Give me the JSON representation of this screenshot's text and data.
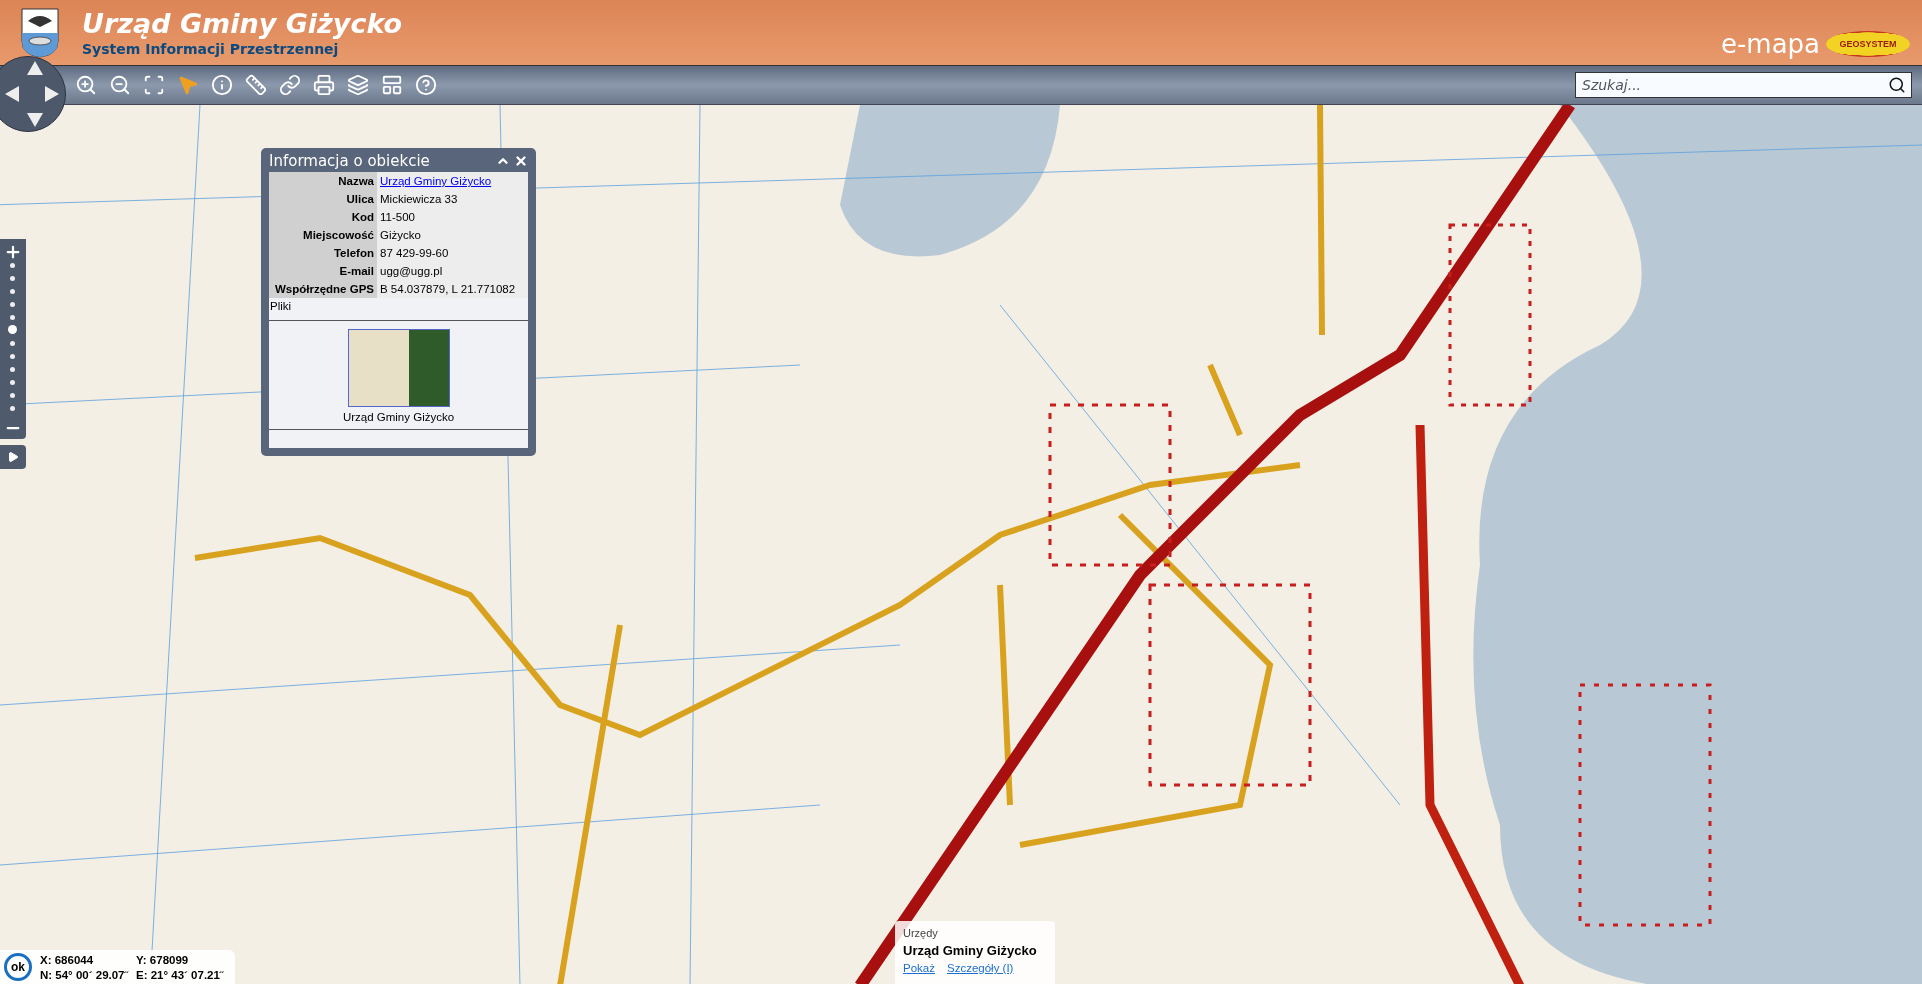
{
  "header": {
    "title": "Urząd Gminy Giżycko",
    "subtitle": "System Informacji Przestrzennej",
    "brand": "e-mapa",
    "brand_badge": "GEOSYSTEM"
  },
  "search": {
    "placeholder": "Szukaj..."
  },
  "zoom_slider": {
    "level": 0.55
  },
  "info_panel": {
    "title": "Informacja o obiekcie",
    "rows": [
      {
        "label": "Nazwa",
        "value": "Urząd Gminy Giżycko",
        "kind": "link"
      },
      {
        "label": "Ulica",
        "value": "Mickiewicza 33",
        "kind": "text"
      },
      {
        "label": "Kod",
        "value": "11-500",
        "kind": "text"
      },
      {
        "label": "Miejscowość",
        "value": "Giżycko",
        "kind": "text"
      },
      {
        "label": "Telefon",
        "value": "87 429-99-60",
        "kind": "text"
      },
      {
        "label": "E-mail",
        "value": "ugg@ugg.pl",
        "kind": "text"
      },
      {
        "label": "Współrzędne GPS",
        "value": "B 54.037879, L 21.771082",
        "kind": "text"
      }
    ],
    "files_label": "Pliki",
    "photo_caption": "Urząd Gminy Giżycko"
  },
  "coordinates": {
    "button": "ok",
    "x": "X: 686044",
    "y": "Y: 678099",
    "n": "N: 54° 00´ 29.07˝",
    "e": "E: 21° 43´ 07.21˝"
  },
  "map_popup": {
    "category": "Urzędy",
    "name": "Urząd Gminy Giżycko",
    "links": [
      "Pokaż",
      "Szczegóły (I)"
    ]
  }
}
